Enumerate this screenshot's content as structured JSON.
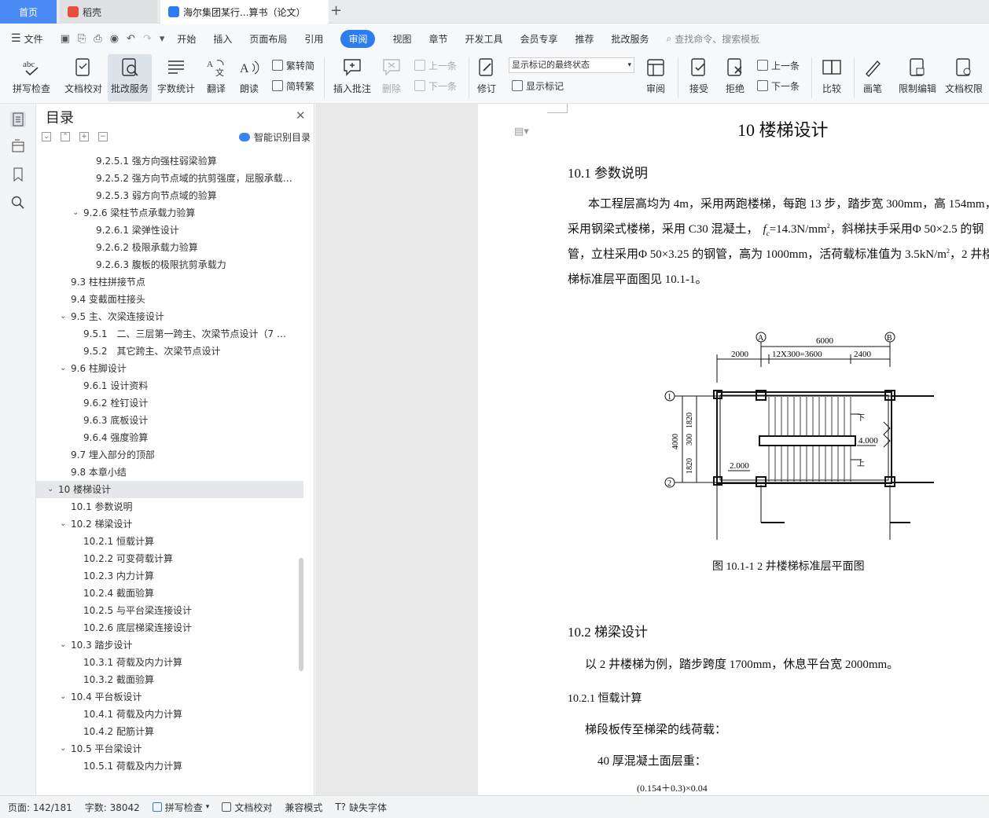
{
  "tabs": {
    "home": "首页",
    "daoke": "稻壳",
    "document": "海尔集团某行...算书（论文）",
    "new_tab": "+"
  },
  "menu": {
    "file": "文件",
    "items": [
      "开始",
      "插入",
      "页面布局",
      "引用",
      "审阅",
      "视图",
      "章节",
      "开发工具",
      "会员专享",
      "推荐",
      "批改服务"
    ],
    "active": "审阅",
    "search": "查找命令、搜索模板"
  },
  "ribbon": {
    "spellcheck": "拼写检查",
    "doc_check": "文档校对",
    "grading": "批改服务",
    "word_count": "字数统计",
    "translate": "翻译",
    "read_aloud": "朗读",
    "to_trad": "繁转简",
    "to_simp": "简转繁",
    "insert_comment": "插入批注",
    "delete": "删除",
    "prev": "上一条",
    "next": "下一条",
    "revise": "修订",
    "markup_state": "显示标记的最终状态",
    "show_markup": "显示标记",
    "review": "审阅",
    "accept": "接受",
    "reject": "拒绝",
    "prev2": "上一条",
    "next2": "下一条",
    "compare": "比较",
    "pen": "画笔",
    "restrict_edit": "限制编辑",
    "doc_permission": "文档权限"
  },
  "toc": {
    "title": "目录",
    "smart": "智能识别目录",
    "items": [
      {
        "text": "9.2.5.1 强方向强柱弱梁验算",
        "level": 4
      },
      {
        "text": "9.2.5.2 强方向节点域的抗剪强度，屈服承载…",
        "level": 4
      },
      {
        "text": "9.2.5.3 弱方向节点域的验算",
        "level": 4
      },
      {
        "text": "9.2.6 梁柱节点承载力验算",
        "level": 3,
        "caret": true
      },
      {
        "text": "9.2.6.1 梁弹性设计",
        "level": 4
      },
      {
        "text": "9.2.6.2 极限承载力验算",
        "level": 4
      },
      {
        "text": "9.2.6.3 腹板的极限抗剪承载力",
        "level": 4
      },
      {
        "text": "9.3 柱柱拼接节点",
        "level": 2
      },
      {
        "text": "9.4 变截面柱接头",
        "level": 2
      },
      {
        "text": "9.5 主、次梁连接设计",
        "level": 2,
        "caret": true
      },
      {
        "text": "9.5.1　二、三层第一跨主、次梁节点设计（7 …",
        "level": 3
      },
      {
        "text": "9.5.2　其它跨主、次梁节点设计",
        "level": 3
      },
      {
        "text": "9.6 柱脚设计",
        "level": 2,
        "caret": true
      },
      {
        "text": "9.6.1  设计资料",
        "level": 3
      },
      {
        "text": "9.6.2 栓钉设计",
        "level": 3
      },
      {
        "text": "9.6.3 底板设计",
        "level": 3
      },
      {
        "text": "9.6.4 强度验算",
        "level": 3
      },
      {
        "text": "9.7 埋入部分的顶部",
        "level": 2
      },
      {
        "text": "9.8 本章小结",
        "level": 2
      },
      {
        "text": "10  楼梯设计",
        "level": 1,
        "caret": true,
        "selected": true
      },
      {
        "text": "10.1 参数说明",
        "level": 2
      },
      {
        "text": "10.2 梯梁设计",
        "level": 2,
        "caret": true
      },
      {
        "text": "10.2.1 恒载计算",
        "level": 3
      },
      {
        "text": "10.2.2 可变荷载计算",
        "level": 3
      },
      {
        "text": "10.2.3 内力计算",
        "level": 3
      },
      {
        "text": "10.2.4 截面验算",
        "level": 3
      },
      {
        "text": "10.2.5 与平台梁连接设计",
        "level": 3
      },
      {
        "text": "10.2.6 底层梯梁连接设计",
        "level": 3
      },
      {
        "text": "10.3 踏步设计",
        "level": 2,
        "caret": true
      },
      {
        "text": "10.3.1 荷载及内力计算",
        "level": 3
      },
      {
        "text": "10.3.2 截面验算",
        "level": 3
      },
      {
        "text": "10.4 平台板设计",
        "level": 2,
        "caret": true
      },
      {
        "text": "10.4.1 荷载及内力计算",
        "level": 3
      },
      {
        "text": "10.4.2 配筋计算",
        "level": 3
      },
      {
        "text": "10.5 平台梁设计",
        "level": 2,
        "caret": true
      },
      {
        "text": "10.5.1 荷载及内力计算",
        "level": 3
      }
    ]
  },
  "doc": {
    "chapter": "10  楼梯设计",
    "s101": "10.1 参数说明",
    "p1_l1": "本工程层高均为 4m，采用两跑楼梯，每跑 13 步，踏步宽 300mm，高 154mm，",
    "p1_l2a": "采用钢梁式楼梯，采用 C30 混凝土，",
    "p1_l2b": "=14.3N/mm",
    "p1_l2c": "，斜梯扶手采用Φ  50×2.5 的钢",
    "p1_l3": "管，立柱采用Φ  50×3.25 的钢管，高为 1000mm，活荷载标准值为 3.5kN/m",
    "p1_l3b": "，2 井楼",
    "p1_l4": "梯标准层平面图见 10.1-1。",
    "figure": {
      "axis_a": "A",
      "axis_b": "B",
      "axis_1": "1",
      "axis_2": "2",
      "top_total": "6000",
      "top_left": "2000",
      "top_mid": "12X300=3600",
      "top_right": "2400",
      "left_total": "4000",
      "left_top": "1820",
      "left_mid": "300",
      "left_bot": "1820",
      "down": "下",
      "up": "上",
      "elev_high": "4.000",
      "elev_low": "2.000"
    },
    "caption": "图 10.1-1 2 井楼梯标准层平面图",
    "s102": "10.2 梯梁设计",
    "p2": "以 2 井楼梯为例，踏步跨度 1700mm，休息平台宽 2000mm。",
    "s1021": "10.2.1 恒载计算",
    "p3": "梯段板传至梯梁的线荷载：",
    "p4": "40 厚混凝土面层重：",
    "formula": "(0.154＋0.3)×0.04"
  },
  "status": {
    "page": "页面: 142/181",
    "words": "字数: 38042",
    "spell": "拼写检查",
    "proof": "文档校对",
    "compat": "兼容模式",
    "font_missing": "缺失字体"
  },
  "colors": {
    "accent": "#2d7cf0",
    "home_tab": "#4a8af4"
  }
}
